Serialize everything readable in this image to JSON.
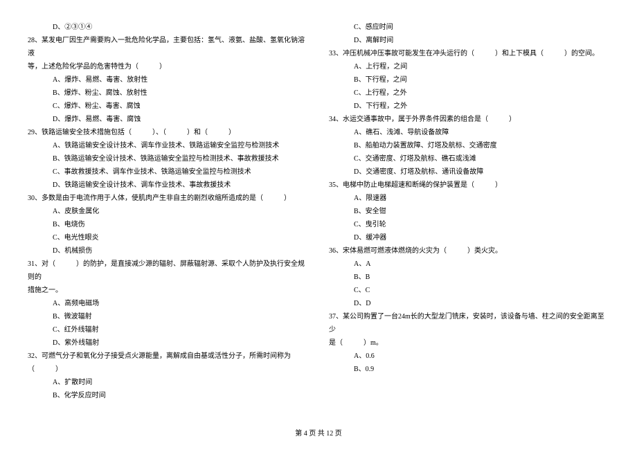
{
  "left": {
    "opt_d_27": "D、②③①④",
    "q28": "28、某发电厂因生产需要购入一批危险化学品，主要包括：氢气、液氨、盐酸、氢氧化钠溶液",
    "q28_cont": "等，上述危险化学品的危害特性为（　　　）",
    "q28_a": "A、爆炸、易燃、毒害、放射性",
    "q28_b": "B、爆炸、粉尘、腐蚀、放射性",
    "q28_c": "C、爆炸、粉尘、毒害、腐蚀",
    "q28_d": "D、爆炸、易燃、毒害、腐蚀",
    "q29": "29、铁路运输安全技术措施包括（　　　）、（　　　）和（　　　）",
    "q29_a": "A、铁路运输安全设计技术、调车作业技术、铁路运输安全监控与检测技术",
    "q29_b": "B、铁路运输安全设计技术、铁路运输安全监控与检测技术、事故救援技术",
    "q29_c": "C、事故救援技术、调车作业技术、铁路运输安全监控与检测技术",
    "q29_d": "D、铁路运输安全设计技术、调车作业技术、事故救援技术",
    "q30": "30、多数是由于电流作用于人体，使肌肉产生非自主的剧烈收缩所造成的是（　　　）",
    "q30_a": "A、皮肤金属化",
    "q30_b": "B、电烧伤",
    "q30_c": "C、电光性眼炎",
    "q30_d": "D、机械损伤",
    "q31": "31、对（　　　）的防护，是直接减少源的辐射、屏蔽辐射源、采取个人防护及执行安全规则的",
    "q31_cont": "措施之一。",
    "q31_a": "A、高频电磁场",
    "q31_b": "B、微波辐射",
    "q31_c": "C、红外线辐射",
    "q31_d": "D、紫外线辐射",
    "q32": "32、可燃气分子和氧化分子接受点火源能量，离解成自由基或活性分子，所需时间称为（　　　）",
    "q32_a": "A、扩散时间",
    "q32_b": "B、化学反应时间"
  },
  "right": {
    "q32_c": "C、感应时间",
    "q32_d": "D、离解时间",
    "q33": "33、冲压机械冲压事故可能发生在冲头运行的（　　　）和上下模具（　　　）的空间。",
    "q33_a": "A、上行程，之间",
    "q33_b": "B、下行程，之间",
    "q33_c": "C、上行程，之外",
    "q33_d": "D、下行程，之外",
    "q34": "34、水运交通事故中，属于外界条件因素的组合是（　　　）",
    "q34_a": "A、礁石、浅滩、导航设备故障",
    "q34_b": "B、船舶动力装置故障、灯塔及航标、交通密度",
    "q34_c": "C、交通密度、灯塔及航标、礁石或浅滩",
    "q34_d": "D、交通密度、灯塔及航标、通讯设备故障",
    "q35": "35、电梯中防止电梯超速和断绳的保护装置是（　　　）",
    "q35_a": "A、限速器",
    "q35_b": "B、安全钳",
    "q35_c": "C、曳引轮",
    "q35_d": "D、缓冲器",
    "q36": "36、宋体易燃可燃液体燃烧的火灾为（　　　）类火灾。",
    "q36_a": "A、A",
    "q36_b": "B、B",
    "q36_c": "C、C",
    "q36_d": "D、D",
    "q37": "37、某公司购置了一台24m长的大型龙门铣床，安装时，该设备与墙、柱之间的安全距离至少",
    "q37_cont": "是（　　　）m。",
    "q37_a": "A、0.6",
    "q37_b": "B、0.9"
  },
  "footer": "第 4 页 共 12 页"
}
